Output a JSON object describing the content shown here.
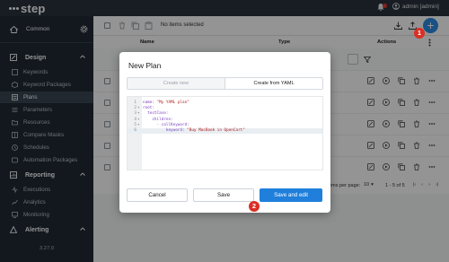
{
  "app": {
    "logo": "step",
    "user": "admin [admin]"
  },
  "sidebar": {
    "project": "Common",
    "sections": [
      {
        "label": "Design",
        "items": [
          {
            "label": "Keywords",
            "icon": "keyword-icon"
          },
          {
            "label": "Keyword Packages",
            "icon": "package-icon"
          },
          {
            "label": "Plans",
            "icon": "plans-icon",
            "active": true
          },
          {
            "label": "Parameters",
            "icon": "list-icon"
          },
          {
            "label": "Resources",
            "icon": "folder-icon"
          },
          {
            "label": "Compare Masks",
            "icon": "mask-icon"
          },
          {
            "label": "Schedules",
            "icon": "clock-icon"
          },
          {
            "label": "Automation Packages",
            "icon": "automation-icon"
          }
        ]
      },
      {
        "label": "Reporting",
        "items": [
          {
            "label": "Executions",
            "icon": "run-icon"
          },
          {
            "label": "Analytics",
            "icon": "chart-icon"
          },
          {
            "label": "Monitoring",
            "icon": "monitor-icon"
          }
        ]
      },
      {
        "label": "Alerting",
        "items": []
      }
    ],
    "version": "3.27.0"
  },
  "toolbar": {
    "status": "No items selected"
  },
  "table": {
    "columns": {
      "name": "Name",
      "type": "Type",
      "actions": "Actions"
    },
    "row_count": 5
  },
  "pagination": {
    "label": "Items per page:",
    "size": "10",
    "range": "1 - 5 of 5"
  },
  "modal": {
    "title": "New Plan",
    "tabs": [
      "Create new",
      "Create from YAML"
    ],
    "active_tab": 1,
    "code": [
      {
        "n": "1",
        "fold": "",
        "parts": [
          {
            "t": "name: ",
            "c": "k"
          },
          {
            "t": "\"My YAML plan\"",
            "c": "s"
          }
        ]
      },
      {
        "n": "2",
        "fold": "▾",
        "parts": [
          {
            "t": "root:",
            "c": "k"
          }
        ]
      },
      {
        "n": "3",
        "fold": "▾",
        "parts": [
          {
            "t": "  testCase:",
            "c": "k"
          }
        ]
      },
      {
        "n": "4",
        "fold": "▾",
        "parts": [
          {
            "t": "    children:",
            "c": "k"
          }
        ]
      },
      {
        "n": "5",
        "fold": "▾",
        "parts": [
          {
            "t": "      - callKeyword:",
            "c": "k"
          }
        ]
      },
      {
        "n": "6",
        "fold": "",
        "parts": [
          {
            "t": "          keyword: ",
            "c": "k"
          },
          {
            "t": "\"Buy MacBook in OpenCart\"",
            "c": "s"
          }
        ]
      }
    ],
    "current_line": 6,
    "buttons": {
      "cancel": "Cancel",
      "save": "Save",
      "save_edit": "Save and edit"
    }
  },
  "callouts": {
    "first": "1",
    "second": "2"
  },
  "colors": {
    "primary": "#1f7fdb",
    "sidebar": "#1f2a35",
    "callout": "#d93025"
  }
}
